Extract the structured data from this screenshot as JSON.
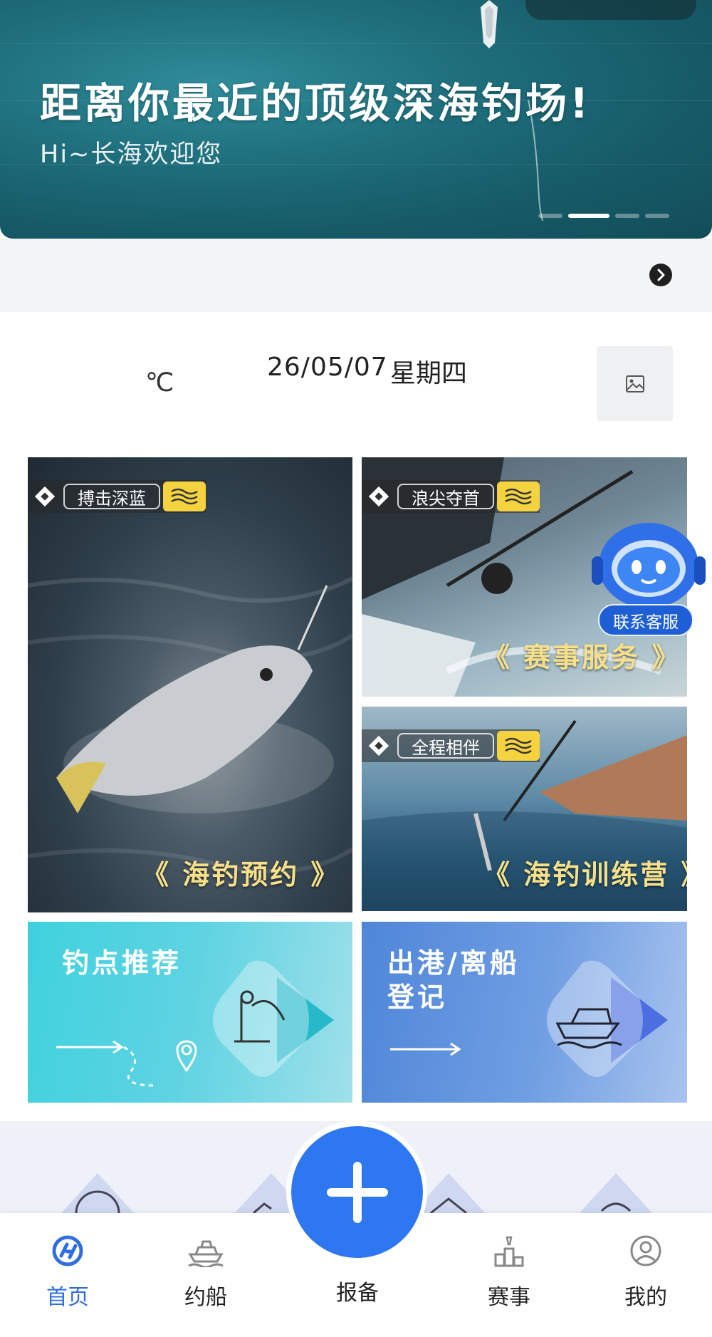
{
  "banner": {
    "title": "距离你最近的顶级深海钓场!",
    "subtitle": "Hi~长海欢迎您",
    "slide_count": 4,
    "active_slide": 2
  },
  "weather": {
    "temperature_unit": "℃",
    "date": "26/05/07",
    "weekday": "星期四"
  },
  "cards": [
    {
      "tag": "搏击深蓝",
      "caption": "《 海钓预约 》"
    },
    {
      "tag": "浪尖夺首",
      "caption": "《 赛事服务 》"
    },
    {
      "tag": "全程相伴",
      "caption": "《 海钓训练营 》"
    }
  ],
  "tiles": {
    "spot": {
      "title": "钓点推荐"
    },
    "port": {
      "title_line1": "出港/离船",
      "title_line2": "登记"
    }
  },
  "customer_service": {
    "label": "联系客服"
  },
  "tabbar": {
    "items": [
      {
        "label": "首页",
        "icon": "home-icon",
        "active": true
      },
      {
        "label": "约船",
        "icon": "boat-icon",
        "active": false
      },
      {
        "label": "报备",
        "icon": "plus-icon",
        "active": false
      },
      {
        "label": "赛事",
        "icon": "podium-icon",
        "active": false
      },
      {
        "label": "我的",
        "icon": "user-icon",
        "active": false
      }
    ]
  },
  "colors": {
    "accent": "#2d78f0",
    "active_tab": "#2f6fe0",
    "tag_yellow": "#f5d33f",
    "caption_yellow": "#f7e08a"
  }
}
